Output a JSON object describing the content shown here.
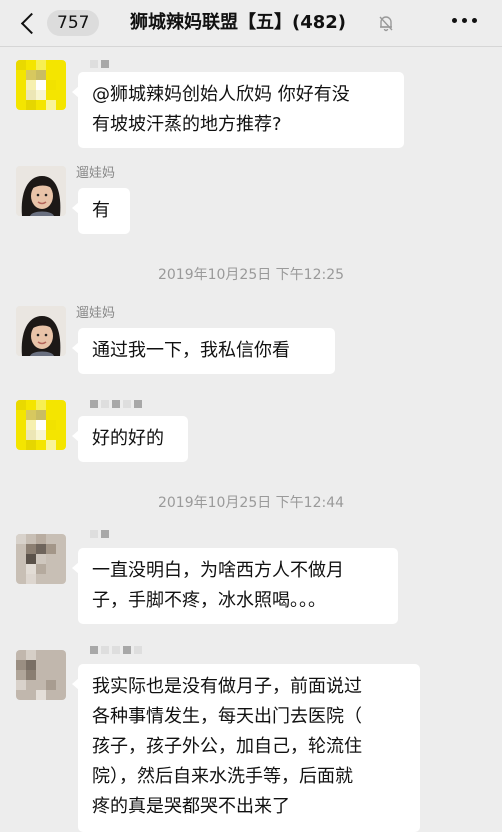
{
  "header": {
    "unread_count": "757",
    "title": "狮城辣妈联盟【五】",
    "member_count": "(482)"
  },
  "messages": [
    {
      "sender": "",
      "avatar": "mosaic-yellow-avatar",
      "lines": [
        "@狮城辣妈创始人欣妈 你好有没",
        "有坡坡汗蒸的地方推荐?"
      ]
    },
    {
      "sender": "遛娃妈",
      "avatar": "girl-photo-avatar",
      "lines": [
        "有"
      ]
    },
    {
      "timestamp": "2019年10月25日 下午12:25"
    },
    {
      "sender": "遛娃妈",
      "avatar": "girl-photo-avatar",
      "lines": [
        "通过我一下，我私信你看"
      ]
    },
    {
      "sender": "",
      "avatar": "mosaic-yellow-avatar",
      "lines": [
        "好的好的"
      ]
    },
    {
      "timestamp": "2019年10月25日 下午12:44"
    },
    {
      "sender": "",
      "avatar": "mosaic-gray-avatar",
      "lines": [
        "一直没明白，为啥西方人不做月",
        "子，手脚不疼，冰水照喝。。。"
      ]
    },
    {
      "sender": "",
      "avatar": "mosaic-gray-avatar",
      "lines": [
        "我实际也是没有做月子，前面说过",
        "各种事情发生，每天出门去医院（",
        "孩子，孩子外公，加自己，轮流住",
        "院），然后自来水洗手等，后面就",
        "疼的真是哭都哭不出来了"
      ]
    }
  ]
}
